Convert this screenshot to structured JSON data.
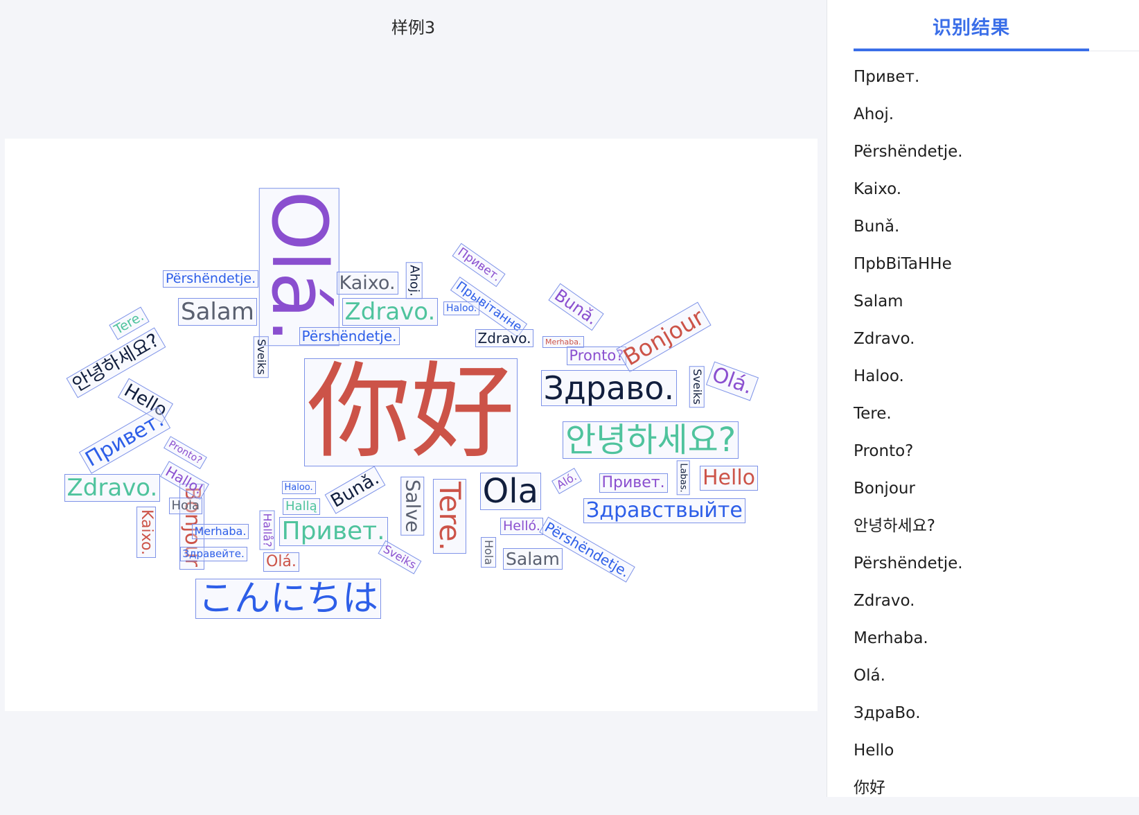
{
  "sample_title": "样例3",
  "results_tab_label": "识别结果",
  "results": [
    "Привет.",
    "Ahoj.",
    "Përshëndetje.",
    "Kaixo.",
    "Bunǎ.",
    "ПрbBiTaHHe",
    "Salam",
    "Zdravo.",
    "Haloo.",
    "Tere.",
    "Pronto?",
    "Bonjour",
    "안녕하세요?",
    "Përshëndetje.",
    "Zdravo.",
    "Merhaba.",
    "Olá.",
    "ЗдраВо.",
    "Hello",
    "你好"
  ],
  "colors": {
    "red": "#cc5348",
    "purple": "#8a4fcf",
    "blue": "#2d5ee8",
    "teal": "#4fc39d",
    "navy": "#111e3d",
    "gray": "#5a6070",
    "accent": "#3a6ee8"
  },
  "cloud_words": [
    {
      "text": "你好",
      "color": "red"
    },
    {
      "text": "Olá.",
      "color": "purple"
    },
    {
      "text": "Përshëndetje.",
      "color": "blue"
    },
    {
      "text": "Salam",
      "color": "gray"
    },
    {
      "text": "Kaixo.",
      "color": "gray"
    },
    {
      "text": "Zdravo.",
      "color": "teal"
    },
    {
      "text": "Ahoj.",
      "color": "navy"
    },
    {
      "text": "Привет.",
      "color": "purple"
    },
    {
      "text": "Прывітанне",
      "color": "blue"
    },
    {
      "text": "Haloo.",
      "color": "blue"
    },
    {
      "text": "Bunǎ.",
      "color": "purple"
    },
    {
      "text": "Përshëndetje.",
      "color": "blue"
    },
    {
      "text": "Zdravo.",
      "color": "navy"
    },
    {
      "text": "Merhaba.",
      "color": "red"
    },
    {
      "text": "Pronto?",
      "color": "purple"
    },
    {
      "text": "Bonjour",
      "color": "red"
    },
    {
      "text": "Tere.",
      "color": "teal"
    },
    {
      "text": "안녕하세요?",
      "color": "navy"
    },
    {
      "text": "Bonjour",
      "color": "red"
    },
    {
      "text": "Sveiks",
      "color": "navy"
    },
    {
      "text": "Здраво.",
      "color": "navy"
    },
    {
      "text": "Sveiks",
      "color": "navy"
    },
    {
      "text": "Olá.",
      "color": "purple"
    },
    {
      "text": "Hello",
      "color": "navy"
    },
    {
      "text": "안녕하세요?",
      "color": "teal"
    },
    {
      "text": "Привет.",
      "color": "blue"
    },
    {
      "text": "Pronto?",
      "color": "purple"
    },
    {
      "text": "Hallo!",
      "color": "purple"
    },
    {
      "text": "Zdravo.",
      "color": "teal"
    },
    {
      "text": "Hola",
      "color": "gray"
    },
    {
      "text": "Kaixo.",
      "color": "red"
    },
    {
      "text": "Merhaba.",
      "color": "blue"
    },
    {
      "text": "Здравейте.",
      "color": "blue"
    },
    {
      "text": "Hallå?",
      "color": "purple"
    },
    {
      "text": "Haloo.",
      "color": "blue"
    },
    {
      "text": "Hallą",
      "color": "teal"
    },
    {
      "text": "Olá.",
      "color": "red"
    },
    {
      "text": "Bunǎ.",
      "color": "navy"
    },
    {
      "text": "Привет.",
      "color": "teal"
    },
    {
      "text": "Salve",
      "color": "gray"
    },
    {
      "text": "Tere.",
      "color": "red"
    },
    {
      "text": "Ola",
      "color": "navy"
    },
    {
      "text": "Sveiks",
      "color": "purple"
    },
    {
      "text": "Hola",
      "color": "gray"
    },
    {
      "text": "Helló.",
      "color": "purple"
    },
    {
      "text": "Salam",
      "color": "gray"
    },
    {
      "text": "Përshëndetje.",
      "color": "blue"
    },
    {
      "text": "Aló.",
      "color": "purple"
    },
    {
      "text": "Привет.",
      "color": "purple"
    },
    {
      "text": "Labas.",
      "color": "navy"
    },
    {
      "text": "Hello",
      "color": "red"
    },
    {
      "text": "Здравствыйте",
      "color": "blue"
    },
    {
      "text": "こんにちは",
      "color": "blue"
    }
  ]
}
